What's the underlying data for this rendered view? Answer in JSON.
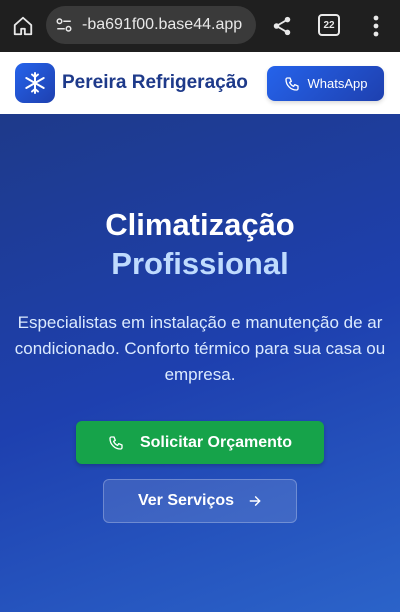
{
  "browser": {
    "url": "-ba691f00.base44.app",
    "tab_count": "22",
    "icons": {
      "home": "home-icon",
      "site": "site-settings-icon",
      "share": "share-icon",
      "tabs": "tab-switcher-icon",
      "menu": "more-vert-icon"
    }
  },
  "header": {
    "brand": "Pereira Refrigeração",
    "logo_icon": "snowflake-icon",
    "whatsapp_label": "WhatsApp",
    "whatsapp_icon": "phone-icon"
  },
  "hero": {
    "title_line1": "Climatização",
    "title_line2": "Profissional",
    "description": "Especialistas em instalação e manutenção de ar condicionado. Conforto térmico para sua casa ou empresa.",
    "primary_button": "Solicitar Orçamento",
    "secondary_button": "Ver Serviços"
  },
  "colors": {
    "brand_blue": "#1e40af",
    "accent_green": "#16a34a",
    "hero_subtitle": "#bfdbfe"
  }
}
